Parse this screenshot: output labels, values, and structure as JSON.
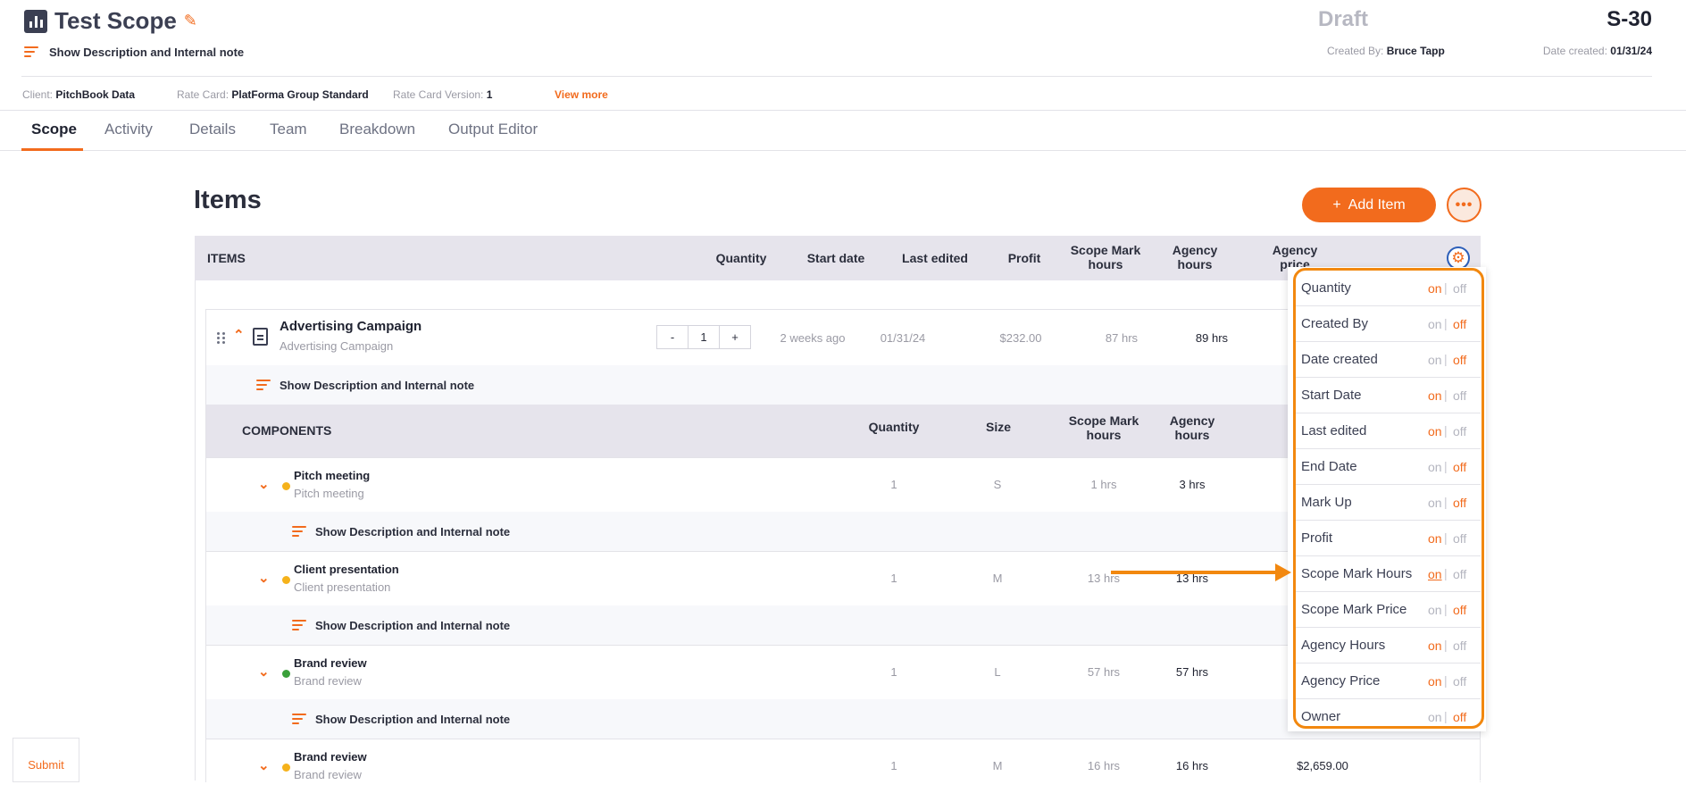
{
  "header": {
    "title": "Test Scope",
    "show_desc_label": "Show Description and Internal note",
    "status": "Draft",
    "code": "S-30",
    "created_by_label": "Created By:",
    "created_by_value": "Bruce Tapp",
    "date_created_label": "Date created:",
    "date_created_value": "01/31/24",
    "client_label": "Client:",
    "client_value": "PitchBook Data",
    "rate_card_label": "Rate Card:",
    "rate_card_value": "PlatForma Group Standard",
    "rate_card_version_label": "Rate Card Version:",
    "rate_card_version_value": "1",
    "view_more": "View more"
  },
  "tabs": [
    {
      "label": "Scope",
      "active": true
    },
    {
      "label": "Activity"
    },
    {
      "label": "Details"
    },
    {
      "label": "Team"
    },
    {
      "label": "Breakdown"
    },
    {
      "label": "Output Editor"
    }
  ],
  "items_section": {
    "title": "Items",
    "add_button": "Add Item",
    "add_icon": "+",
    "more_icon": "•••",
    "columns": {
      "items": "ITEMS",
      "quantity": "Quantity",
      "start_date": "Start date",
      "last_edited": "Last edited",
      "profit": "Profit",
      "scope_mark_hours_1": "Scope Mark",
      "scope_mark_hours_2": "hours",
      "agency_hours_1": "Agency",
      "agency_hours_2": "hours",
      "agency_price_1": "Agency",
      "agency_price_2": "price"
    }
  },
  "item": {
    "name": "Advertising Campaign",
    "subtitle": "Advertising Campaign",
    "stepper_minus": "-",
    "quantity": "1",
    "stepper_plus": "+",
    "start_date": "2 weeks ago",
    "last_edited": "01/31/24",
    "profit": "$232.00",
    "scope_mark_hours": "87 hrs",
    "agency_hours": "89 hrs",
    "show_desc_label": "Show Description and Internal note"
  },
  "components": {
    "header": {
      "title": "COMPONENTS",
      "quantity": "Quantity",
      "size": "Size",
      "scope_mark_hours_1": "Scope Mark",
      "scope_mark_hours_2": "hours",
      "agency_hours_1": "Agency",
      "agency_hours_2": "hours"
    },
    "show_desc_label": "Show Description and Internal note",
    "rows": [
      {
        "name": "Pitch meeting",
        "subtitle": "Pitch meeting",
        "dot_color": "#f5b21b",
        "quantity": "1",
        "size": "S",
        "scope_mark_hours": "1 hrs",
        "agency_hours": "3 hrs",
        "agency_price": ""
      },
      {
        "name": "Client presentation",
        "subtitle": "Client presentation",
        "dot_color": "#f5b21b",
        "quantity": "1",
        "size": "M",
        "scope_mark_hours": "13 hrs",
        "agency_hours": "13 hrs",
        "agency_price": ""
      },
      {
        "name": "Brand review",
        "subtitle": "Brand review",
        "dot_color": "#3aa03a",
        "quantity": "1",
        "size": "L",
        "scope_mark_hours": "57 hrs",
        "agency_hours": "57 hrs",
        "agency_price": ""
      },
      {
        "name": "Brand review",
        "subtitle": "Brand review",
        "dot_color": "#f5b21b",
        "quantity": "1",
        "size": "M",
        "scope_mark_hours": "16 hrs",
        "agency_hours": "16 hrs",
        "agency_price": "$2,659.00"
      }
    ]
  },
  "column_toggles": {
    "on_label": "on",
    "off_label": "off",
    "separator": "|",
    "items": [
      {
        "label": "Quantity",
        "state": "on"
      },
      {
        "label": "Created By",
        "state": "off"
      },
      {
        "label": "Date created",
        "state": "off"
      },
      {
        "label": "Start Date",
        "state": "on"
      },
      {
        "label": "Last edited",
        "state": "on"
      },
      {
        "label": "End Date",
        "state": "off"
      },
      {
        "label": "Mark Up",
        "state": "off"
      },
      {
        "label": "Profit",
        "state": "on"
      },
      {
        "label": "Scope Mark Hours",
        "state": "on",
        "hovered": true
      },
      {
        "label": "Scope Mark Price",
        "state": "off"
      },
      {
        "label": "Agency Hours",
        "state": "on"
      },
      {
        "label": "Agency Price",
        "state": "on"
      },
      {
        "label": "Owner",
        "state": "off"
      }
    ]
  },
  "submit_label": "Submit",
  "colors": {
    "accent": "#f26b1d",
    "highlight": "#f2880f",
    "header_bg": "#e6e4ec"
  },
  "icons": [
    "app-chart-icon",
    "pencil-icon",
    "description-lines-icon",
    "plus-icon",
    "more-dots-icon",
    "gear-icon",
    "drag-handle-icon",
    "chevron-up-icon",
    "document-icon",
    "chevron-down-icon",
    "status-dot-icon",
    "arrow-annotation-icon"
  ]
}
